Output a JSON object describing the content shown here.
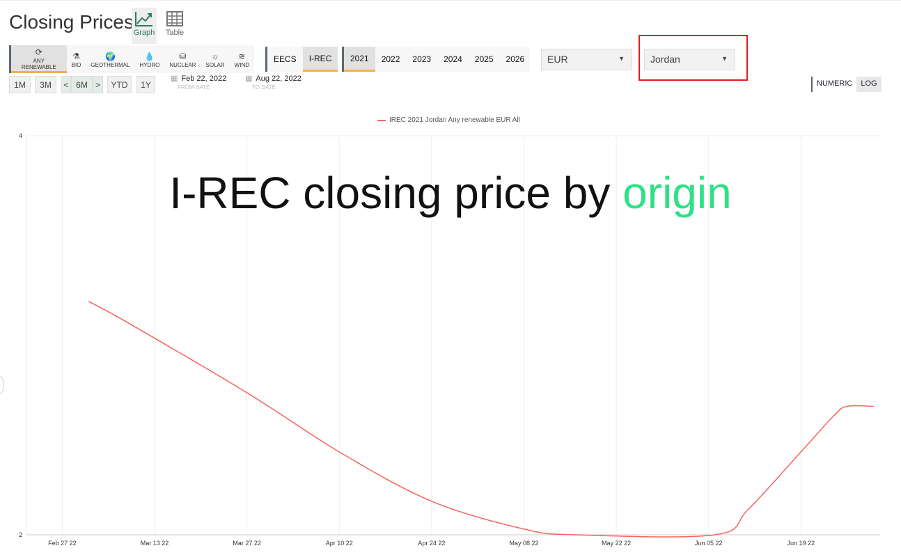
{
  "header": {
    "title": "Closing Prices",
    "views": [
      {
        "label": "Graph",
        "icon": "line-chart-icon",
        "active": true
      },
      {
        "label": "Table",
        "icon": "table-icon",
        "active": false
      }
    ]
  },
  "categories": [
    {
      "label": "ANY RENEWABLE",
      "icon": "⟳",
      "active": true
    },
    {
      "label": "BIO",
      "icon": "⚗"
    },
    {
      "label": "GEOTHERMAL",
      "icon": "🌍"
    },
    {
      "label": "HYDRO",
      "icon": "💧"
    },
    {
      "label": "NUCLEAR",
      "icon": "⛁"
    },
    {
      "label": "SOLAR",
      "icon": "☼"
    },
    {
      "label": "WIND",
      "icon": "≋"
    }
  ],
  "registries": [
    {
      "label": "EECS"
    },
    {
      "label": "I-REC",
      "active": true
    }
  ],
  "years": [
    {
      "label": "2021",
      "active": true
    },
    {
      "label": "2022"
    },
    {
      "label": "2023"
    },
    {
      "label": "2024"
    },
    {
      "label": "2025"
    },
    {
      "label": "2026"
    }
  ],
  "currency": {
    "value": "EUR"
  },
  "country": {
    "value": "Jordan"
  },
  "ranges": {
    "m1": "1M",
    "m3": "3M",
    "prev": "<",
    "m6": "6M",
    "next": ">",
    "ytd": "YTD",
    "y1": "1Y"
  },
  "dates": {
    "from": "Feb 22, 2022",
    "from_label": "FROM DATE",
    "to": "Aug 22, 2022",
    "to_label": "TO DATE"
  },
  "scale": {
    "numeric": "NUMERIC",
    "log": "LOG",
    "active": "LOG"
  },
  "overlay": {
    "text": "I-REC closing price by ",
    "accent": "origin",
    "accent_color": "#2fe086"
  },
  "chart_data": {
    "type": "line",
    "legend": "IREC 2021 Jordan Any renewable EUR All",
    "color": "#f8645c",
    "y_scale": "log",
    "ylim": [
      2,
      4
    ],
    "y_ticks": [
      "2",
      "4"
    ],
    "xlim": [
      "2022-02-22",
      "2022-07-01"
    ],
    "x_ticks": [
      {
        "date": "2022-02-27",
        "label": "Feb 27 22"
      },
      {
        "date": "2022-03-13",
        "label": "Mar 13 22"
      },
      {
        "date": "2022-03-27",
        "label": "Mar 27 22"
      },
      {
        "date": "2022-04-10",
        "label": "Apr 10 22"
      },
      {
        "date": "2022-04-24",
        "label": "Apr 24 22"
      },
      {
        "date": "2022-05-08",
        "label": "May 08 22"
      },
      {
        "date": "2022-05-22",
        "label": "May 22 22"
      },
      {
        "date": "2022-06-05",
        "label": "Jun 05 22"
      },
      {
        "date": "2022-06-19",
        "label": "Jun 19 22"
      }
    ],
    "grid": true,
    "series": [
      {
        "points": [
          [
            "2022-03-03",
            3.0
          ],
          [
            "2022-03-09",
            2.89
          ],
          [
            "2022-03-27",
            2.56
          ],
          [
            "2022-04-10",
            2.31
          ],
          [
            "2022-04-24",
            2.12
          ],
          [
            "2022-05-08",
            2.02
          ],
          [
            "2022-05-16",
            2.0
          ],
          [
            "2022-06-06",
            2.0
          ],
          [
            "2022-06-11",
            2.09
          ],
          [
            "2022-06-19",
            2.31
          ],
          [
            "2022-06-24",
            2.46
          ],
          [
            "2022-06-26",
            2.5
          ],
          [
            "2022-06-30",
            2.5
          ]
        ]
      }
    ]
  }
}
